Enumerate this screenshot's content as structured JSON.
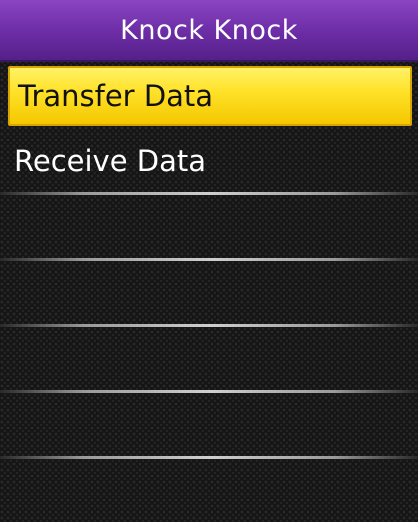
{
  "header": {
    "title": "Knock Knock"
  },
  "menu": {
    "items": [
      {
        "label": "Transfer Data",
        "selected": true
      },
      {
        "label": "Receive Data",
        "selected": false
      }
    ]
  },
  "colors": {
    "header_purple": "#6e2ea8",
    "selection_yellow": "#ffe22a",
    "background": "#151515",
    "text": "#ffffff"
  }
}
